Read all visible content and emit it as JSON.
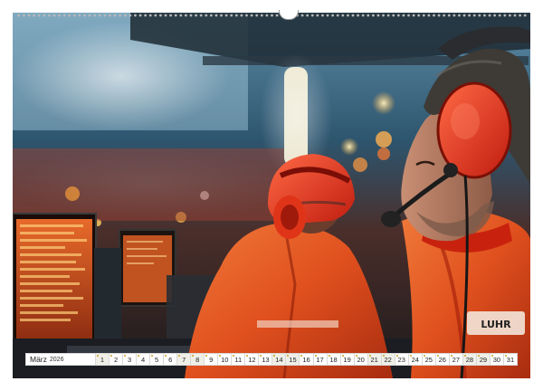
{
  "calendar": {
    "month": "März",
    "year": "2026",
    "days": [
      "1",
      "2",
      "3",
      "4",
      "5",
      "6",
      "7",
      "8",
      "9",
      "10",
      "11",
      "12",
      "13",
      "14",
      "15",
      "16",
      "17",
      "18",
      "19",
      "20",
      "21",
      "22",
      "23",
      "24",
      "25",
      "26",
      "27",
      "28",
      "29",
      "30",
      "31"
    ],
    "weekend_days": [
      "1",
      "7",
      "8",
      "14",
      "15",
      "21",
      "22",
      "28",
      "29"
    ]
  },
  "photo": {
    "palette": {
      "suit": "#e0401a",
      "headset": "#e8321c",
      "screen": "#d4511e",
      "sky": "#3d7a99"
    },
    "suit_badge": "LUHR"
  }
}
